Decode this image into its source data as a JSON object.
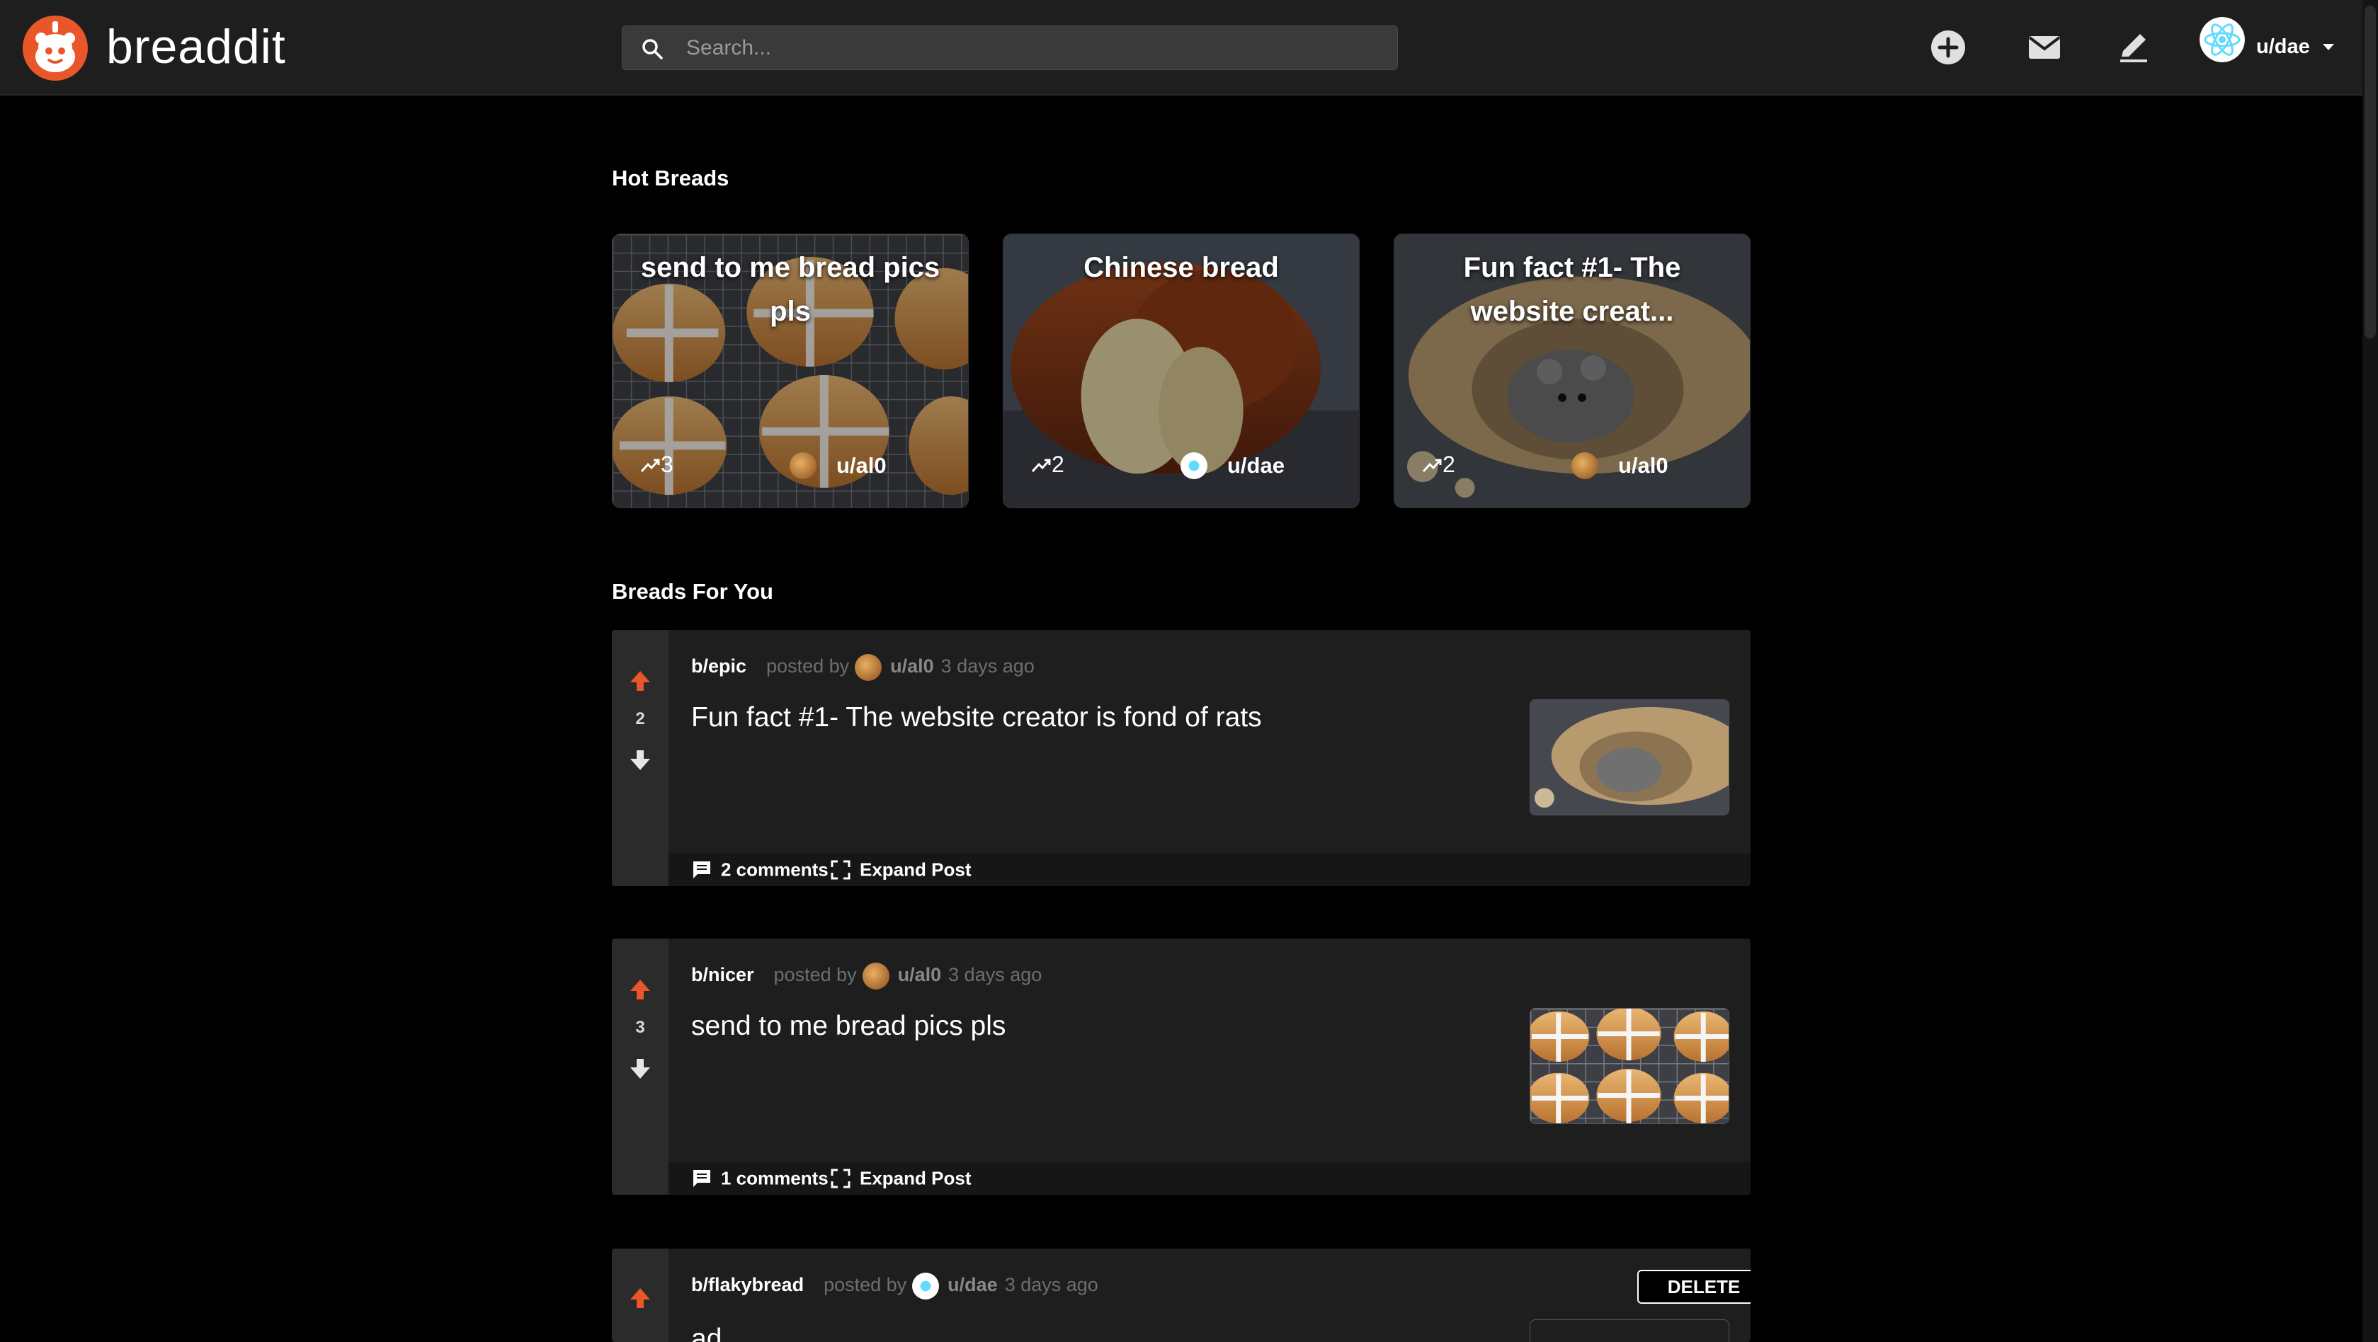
{
  "app": {
    "brand": "breaddit"
  },
  "search": {
    "placeholder": "Search..."
  },
  "header": {
    "icons": [
      "plus-circle-icon",
      "mail-icon",
      "pencil-icon"
    ],
    "user": {
      "name": "u/dae"
    }
  },
  "hot": {
    "title": "Hot Breads",
    "cards": [
      {
        "title": "send to me bread pics pls",
        "score": "3",
        "author": "u/al0"
      },
      {
        "title": "Chinese bread",
        "score": "2",
        "author": "u/dae"
      },
      {
        "title": "Fun fact #1- The website creat...",
        "score": "2",
        "author": "u/al0"
      }
    ]
  },
  "feed": {
    "title": "Breads For You",
    "posted_by": "posted by",
    "expand_label": "Expand Post",
    "delete_label": "DELETE",
    "posts": [
      {
        "sub": "b/epic",
        "author": "u/al0",
        "when": "3 days ago",
        "title": "Fun fact #1- The website creator is fond of rats",
        "score": "2",
        "comments": "2 comments"
      },
      {
        "sub": "b/nicer",
        "author": "u/al0",
        "when": "3 days ago",
        "title": "send to me bread pics pls",
        "score": "3",
        "comments": "1 comments"
      },
      {
        "sub": "b/flakybread",
        "author": "u/dae",
        "when": "3 days ago",
        "title": "ad",
        "score": "",
        "comments": ""
      }
    ]
  },
  "colors": {
    "accent": "#e8562a",
    "background": "#000000",
    "card": "#1e1e1e"
  }
}
